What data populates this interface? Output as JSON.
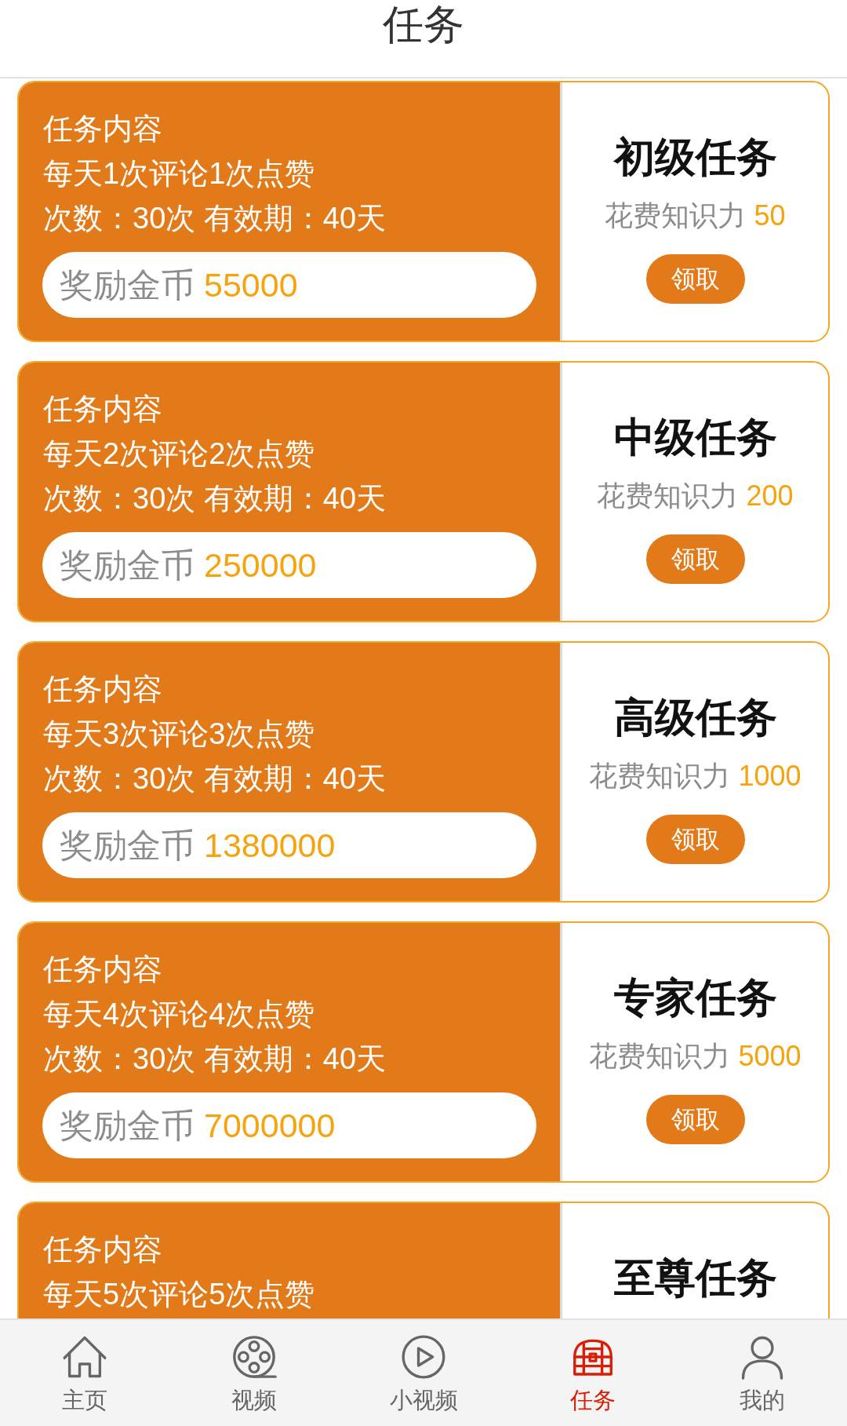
{
  "header": {
    "title": "任务"
  },
  "tasks": [
    {
      "section_label": "任务内容",
      "description": "每天1次评论1次点赞",
      "terms": "次数：30次 有效期：40天",
      "reward": {
        "label": "奖励金币",
        "amount": "55000"
      },
      "level_title": "初级任务",
      "cost": {
        "label": "花费知识力",
        "amount": "50"
      },
      "button": "领取"
    },
    {
      "section_label": "任务内容",
      "description": "每天2次评论2次点赞",
      "terms": "次数：30次 有效期：40天",
      "reward": {
        "label": "奖励金币",
        "amount": "250000"
      },
      "level_title": "中级任务",
      "cost": {
        "label": "花费知识力",
        "amount": "200"
      },
      "button": "领取"
    },
    {
      "section_label": "任务内容",
      "description": "每天3次评论3次点赞",
      "terms": "次数：30次 有效期：40天",
      "reward": {
        "label": "奖励金币",
        "amount": "1380000"
      },
      "level_title": "高级任务",
      "cost": {
        "label": "花费知识力",
        "amount": "1000"
      },
      "button": "领取"
    },
    {
      "section_label": "任务内容",
      "description": "每天4次评论4次点赞",
      "terms": "次数：30次 有效期：40天",
      "reward": {
        "label": "奖励金币",
        "amount": "7000000"
      },
      "level_title": "专家任务",
      "cost": {
        "label": "花费知识力",
        "amount": "5000"
      },
      "button": "领取"
    },
    {
      "section_label": "任务内容",
      "description": "每天5次评论5次点赞",
      "level_title": "至尊任务"
    }
  ],
  "tab_bar": [
    {
      "label": "主页",
      "selected": false
    },
    {
      "label": "视频",
      "selected": false
    },
    {
      "label": "小视频",
      "selected": false
    },
    {
      "label": "任务",
      "selected": true
    },
    {
      "label": "我的",
      "selected": false
    }
  ]
}
